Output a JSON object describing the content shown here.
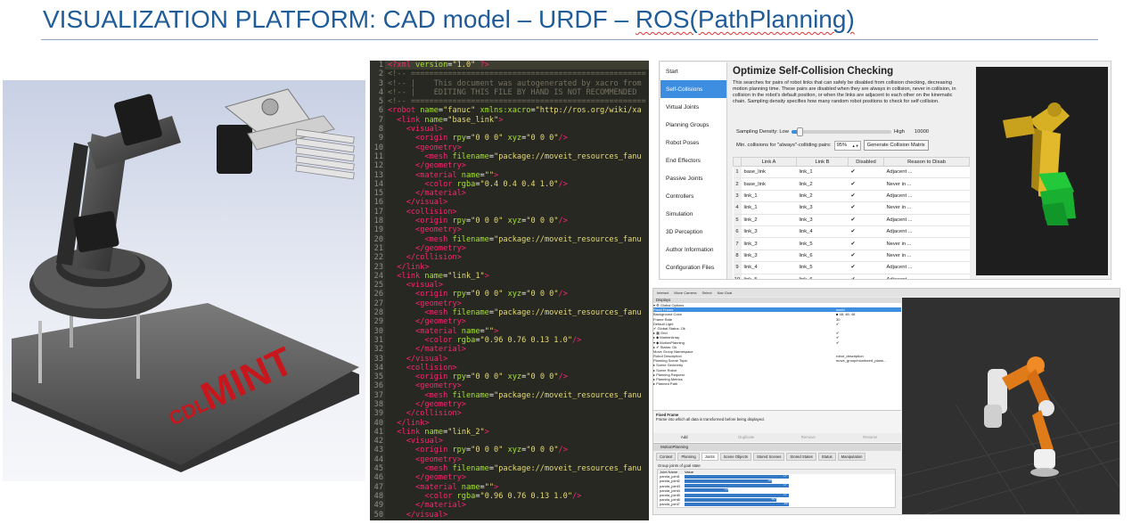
{
  "slide": {
    "title_prefix": "VISUALIZATION PLATFORM: CAD model – URDF – ",
    "title_ros": "ROS(PathPlanning)"
  },
  "cad": {
    "logo_small": "CDL",
    "logo_big": "MINT",
    "logo_color": "#c8161d"
  },
  "code": {
    "lines": [
      [
        [
          "tag",
          "<?xml "
        ],
        [
          "attr",
          "version"
        ],
        [
          "plain",
          "="
        ],
        [
          "str",
          "\"1.0\""
        ],
        [
          "tag",
          " ?>"
        ]
      ],
      [
        [
          "com",
          "<!-- ==================================================="
        ]
      ],
      [
        [
          "com",
          "<!-- |    This document was autogenerated by xacro from"
        ]
      ],
      [
        [
          "com",
          "<!-- |    EDITING THIS FILE BY HAND IS NOT RECOMMENDED"
        ]
      ],
      [
        [
          "com",
          "<!-- ==================================================="
        ]
      ],
      [
        [
          "tag",
          "<robot "
        ],
        [
          "attr",
          "name"
        ],
        [
          "plain",
          "="
        ],
        [
          "str",
          "\"fanuc\" "
        ],
        [
          "attr",
          "xmlns:xacro"
        ],
        [
          "plain",
          "="
        ],
        [
          "str",
          "\"http://ros.org/wiki/xa"
        ]
      ],
      [
        [
          "plain",
          "  "
        ],
        [
          "tag",
          "<link "
        ],
        [
          "attr",
          "name"
        ],
        [
          "plain",
          "="
        ],
        [
          "str",
          "\"base_link\""
        ],
        [
          "tag",
          ">"
        ]
      ],
      [
        [
          "plain",
          "    "
        ],
        [
          "tag",
          "<visual>"
        ]
      ],
      [
        [
          "plain",
          "      "
        ],
        [
          "tag",
          "<origin "
        ],
        [
          "attr",
          "rpy"
        ],
        [
          "plain",
          "="
        ],
        [
          "str",
          "\"0 0 0\" "
        ],
        [
          "attr",
          "xyz"
        ],
        [
          "plain",
          "="
        ],
        [
          "str",
          "\"0 0 0\""
        ],
        [
          "tag",
          "/>"
        ]
      ],
      [
        [
          "plain",
          "      "
        ],
        [
          "tag",
          "<geometry>"
        ]
      ],
      [
        [
          "plain",
          "        "
        ],
        [
          "tag",
          "<mesh "
        ],
        [
          "attr",
          "filename"
        ],
        [
          "plain",
          "="
        ],
        [
          "str",
          "\"package://moveit_resources_fanu"
        ]
      ],
      [
        [
          "plain",
          "      "
        ],
        [
          "tag",
          "</geometry>"
        ]
      ],
      [
        [
          "plain",
          "      "
        ],
        [
          "tag",
          "<material "
        ],
        [
          "attr",
          "name"
        ],
        [
          "plain",
          "="
        ],
        [
          "str",
          "\"\""
        ],
        [
          "tag",
          ">"
        ]
      ],
      [
        [
          "plain",
          "        "
        ],
        [
          "tag",
          "<color "
        ],
        [
          "attr",
          "rgba"
        ],
        [
          "plain",
          "="
        ],
        [
          "str",
          "\"0.4 0.4 0.4 1.0\""
        ],
        [
          "tag",
          "/>"
        ]
      ],
      [
        [
          "plain",
          "      "
        ],
        [
          "tag",
          "</material>"
        ]
      ],
      [
        [
          "plain",
          "    "
        ],
        [
          "tag",
          "</visual>"
        ]
      ],
      [
        [
          "plain",
          "    "
        ],
        [
          "tag",
          "<collision>"
        ]
      ],
      [
        [
          "plain",
          "      "
        ],
        [
          "tag",
          "<origin "
        ],
        [
          "attr",
          "rpy"
        ],
        [
          "plain",
          "="
        ],
        [
          "str",
          "\"0 0 0\" "
        ],
        [
          "attr",
          "xyz"
        ],
        [
          "plain",
          "="
        ],
        [
          "str",
          "\"0 0 0\""
        ],
        [
          "tag",
          "/>"
        ]
      ],
      [
        [
          "plain",
          "      "
        ],
        [
          "tag",
          "<geometry>"
        ]
      ],
      [
        [
          "plain",
          "        "
        ],
        [
          "tag",
          "<mesh "
        ],
        [
          "attr",
          "filename"
        ],
        [
          "plain",
          "="
        ],
        [
          "str",
          "\"package://moveit_resources_fanu"
        ]
      ],
      [
        [
          "plain",
          "      "
        ],
        [
          "tag",
          "</geometry>"
        ]
      ],
      [
        [
          "plain",
          "    "
        ],
        [
          "tag",
          "</collision>"
        ]
      ],
      [
        [
          "plain",
          "  "
        ],
        [
          "tag",
          "</link>"
        ]
      ],
      [
        [
          "plain",
          "  "
        ],
        [
          "tag",
          "<link "
        ],
        [
          "attr",
          "name"
        ],
        [
          "plain",
          "="
        ],
        [
          "str",
          "\"link_1\""
        ],
        [
          "tag",
          ">"
        ]
      ],
      [
        [
          "plain",
          "    "
        ],
        [
          "tag",
          "<visual>"
        ]
      ],
      [
        [
          "plain",
          "      "
        ],
        [
          "tag",
          "<origin "
        ],
        [
          "attr",
          "rpy"
        ],
        [
          "plain",
          "="
        ],
        [
          "str",
          "\"0 0 0\" "
        ],
        [
          "attr",
          "xyz"
        ],
        [
          "plain",
          "="
        ],
        [
          "str",
          "\"0 0 0\""
        ],
        [
          "tag",
          "/>"
        ]
      ],
      [
        [
          "plain",
          "      "
        ],
        [
          "tag",
          "<geometry>"
        ]
      ],
      [
        [
          "plain",
          "        "
        ],
        [
          "tag",
          "<mesh "
        ],
        [
          "attr",
          "filename"
        ],
        [
          "plain",
          "="
        ],
        [
          "str",
          "\"package://moveit_resources_fanu"
        ]
      ],
      [
        [
          "plain",
          "      "
        ],
        [
          "tag",
          "</geometry>"
        ]
      ],
      [
        [
          "plain",
          "      "
        ],
        [
          "tag",
          "<material "
        ],
        [
          "attr",
          "name"
        ],
        [
          "plain",
          "="
        ],
        [
          "str",
          "\"\""
        ],
        [
          "tag",
          ">"
        ]
      ],
      [
        [
          "plain",
          "        "
        ],
        [
          "tag",
          "<color "
        ],
        [
          "attr",
          "rgba"
        ],
        [
          "plain",
          "="
        ],
        [
          "str",
          "\"0.96 0.76 0.13 1.0\""
        ],
        [
          "tag",
          "/>"
        ]
      ],
      [
        [
          "plain",
          "      "
        ],
        [
          "tag",
          "</material>"
        ]
      ],
      [
        [
          "plain",
          "    "
        ],
        [
          "tag",
          "</visual>"
        ]
      ],
      [
        [
          "plain",
          "    "
        ],
        [
          "tag",
          "<collision>"
        ]
      ],
      [
        [
          "plain",
          "      "
        ],
        [
          "tag",
          "<origin "
        ],
        [
          "attr",
          "rpy"
        ],
        [
          "plain",
          "="
        ],
        [
          "str",
          "\"0 0 0\" "
        ],
        [
          "attr",
          "xyz"
        ],
        [
          "plain",
          "="
        ],
        [
          "str",
          "\"0 0 0\""
        ],
        [
          "tag",
          "/>"
        ]
      ],
      [
        [
          "plain",
          "      "
        ],
        [
          "tag",
          "<geometry>"
        ]
      ],
      [
        [
          "plain",
          "        "
        ],
        [
          "tag",
          "<mesh "
        ],
        [
          "attr",
          "filename"
        ],
        [
          "plain",
          "="
        ],
        [
          "str",
          "\"package://moveit_resources_fanu"
        ]
      ],
      [
        [
          "plain",
          "      "
        ],
        [
          "tag",
          "</geometry>"
        ]
      ],
      [
        [
          "plain",
          "    "
        ],
        [
          "tag",
          "</collision>"
        ]
      ],
      [
        [
          "plain",
          "  "
        ],
        [
          "tag",
          "</link>"
        ]
      ],
      [
        [
          "plain",
          "  "
        ],
        [
          "tag",
          "<link "
        ],
        [
          "attr",
          "name"
        ],
        [
          "plain",
          "="
        ],
        [
          "str",
          "\"link_2\""
        ],
        [
          "tag",
          ">"
        ]
      ],
      [
        [
          "plain",
          "    "
        ],
        [
          "tag",
          "<visual>"
        ]
      ],
      [
        [
          "plain",
          "      "
        ],
        [
          "tag",
          "<origin "
        ],
        [
          "attr",
          "rpy"
        ],
        [
          "plain",
          "="
        ],
        [
          "str",
          "\"0 0 0\" "
        ],
        [
          "attr",
          "xyz"
        ],
        [
          "plain",
          "="
        ],
        [
          "str",
          "\"0 0 0\""
        ],
        [
          "tag",
          "/>"
        ]
      ],
      [
        [
          "plain",
          "      "
        ],
        [
          "tag",
          "<geometry>"
        ]
      ],
      [
        [
          "plain",
          "        "
        ],
        [
          "tag",
          "<mesh "
        ],
        [
          "attr",
          "filename"
        ],
        [
          "plain",
          "="
        ],
        [
          "str",
          "\"package://moveit_resources_fanu"
        ]
      ],
      [
        [
          "plain",
          "      "
        ],
        [
          "tag",
          "</geometry>"
        ]
      ],
      [
        [
          "plain",
          "      "
        ],
        [
          "tag",
          "<material "
        ],
        [
          "attr",
          "name"
        ],
        [
          "plain",
          "="
        ],
        [
          "str",
          "\"\""
        ],
        [
          "tag",
          ">"
        ]
      ],
      [
        [
          "plain",
          "        "
        ],
        [
          "tag",
          "<color "
        ],
        [
          "attr",
          "rgba"
        ],
        [
          "plain",
          "="
        ],
        [
          "str",
          "\"0.96 0.76 0.13 1.0\""
        ],
        [
          "tag",
          "/>"
        ]
      ],
      [
        [
          "plain",
          "      "
        ],
        [
          "tag",
          "</material>"
        ]
      ],
      [
        [
          "plain",
          "    "
        ],
        [
          "tag",
          "</visual>"
        ]
      ]
    ]
  },
  "setup_assistant": {
    "sidebar": [
      "Start",
      "Self-Collisions",
      "Virtual Joints",
      "Planning Groups",
      "Robot Poses",
      "End Effectors",
      "Passive Joints",
      "Controllers",
      "Simulation",
      "3D Perception",
      "Author Information",
      "Configuration Files"
    ],
    "active_index": 1,
    "title": "Optimize Self-Collision Checking",
    "description": "This searches for pairs of robot links that can safely be disabled from collision checking, decreasing motion planning time. These pairs are disabled when they are always in collision, never in collision, in collision in the robot's default position, or when the links are adjacent to each other on the kinematic chain. Sampling density specifies how many random robot positions to check for self collision.",
    "density_label": "Sampling Density: Low",
    "density_high": "High",
    "density_value": "10000",
    "density_fraction": 0.08,
    "min_collisions_label": "Min. collisions for \"always\"-colliding pairs:",
    "min_collisions_value": "95%",
    "generate_button": "Generate Collision Matrix",
    "columns": [
      "Link A",
      "Link B",
      "Disabled",
      "Reason to Disab"
    ],
    "rows": [
      {
        "n": "1",
        "a": "base_link",
        "b": "link_1",
        "d": "✔",
        "r": "Adjacent ..."
      },
      {
        "n": "2",
        "a": "base_link",
        "b": "link_2",
        "d": "✔",
        "r": "Never in ..."
      },
      {
        "n": "3",
        "a": "link_1",
        "b": "link_2",
        "d": "✔",
        "r": "Adjacent ..."
      },
      {
        "n": "4",
        "a": "link_1",
        "b": "link_3",
        "d": "✔",
        "r": "Never in ..."
      },
      {
        "n": "5",
        "a": "link_2",
        "b": "link_3",
        "d": "✔",
        "r": "Adjacent ..."
      },
      {
        "n": "6",
        "a": "link_3",
        "b": "link_4",
        "d": "✔",
        "r": "Adjacent ..."
      },
      {
        "n": "7",
        "a": "link_3",
        "b": "link_5",
        "d": "✔",
        "r": "Never in ..."
      },
      {
        "n": "8",
        "a": "link_3",
        "b": "link_6",
        "d": "✔",
        "r": "Never in ..."
      },
      {
        "n": "9",
        "a": "link_4",
        "b": "link_5",
        "d": "✔",
        "r": "Adjacent ..."
      },
      {
        "n": "10",
        "a": "link_5",
        "b": "link_6",
        "d": "✔",
        "r": "Adjacent ..."
      }
    ]
  },
  "rviz": {
    "toolbar": [
      "Interact",
      "Move Camera",
      "Select",
      "Nav Goal"
    ],
    "displays_header": "Displays",
    "tree": [
      {
        "k": "▾ ⚙ Global Options",
        "v": ""
      },
      {
        "k": "      Fixed Frame",
        "v": "world",
        "sel": true
      },
      {
        "k": "      Background Color",
        "v": "■ 48; 48; 48"
      },
      {
        "k": "      Frame Rate",
        "v": "30"
      },
      {
        "k": "      Default Light",
        "v": "✔"
      },
      {
        "k": "  ✔ Global Status: Ok",
        "v": ""
      },
      {
        "k": "▸ ▦ Grid",
        "v": "✔"
      },
      {
        "k": "▸ ◆ MarkerArray",
        "v": "✔"
      },
      {
        "k": "▾ ◆ MotionPlanning",
        "v": "✔"
      },
      {
        "k": "   ▸ ✔ Status: Ok",
        "v": ""
      },
      {
        "k": "      Move Group Namespace",
        "v": ""
      },
      {
        "k": "      Robot Description",
        "v": "robot_description"
      },
      {
        "k": "      Planning Scene Topic",
        "v": "move_group/monitored_plann..."
      },
      {
        "k": "   ▸ Scene Geometry",
        "v": ""
      },
      {
        "k": "   ▸ Scene Robot",
        "v": ""
      },
      {
        "k": "   ▸ Planning Request",
        "v": ""
      },
      {
        "k": "   ▸ Planning Metrics",
        "v": ""
      },
      {
        "k": "   ▸ Planned Path",
        "v": ""
      }
    ],
    "ff_title": "Fixed Frame",
    "ff_desc": "Frame into which all data is transformed before being displayed.",
    "buttons": [
      "Add",
      "Duplicate",
      "Remove",
      "Rename"
    ],
    "mp_header": "MotionPlanning",
    "tabs": [
      "Context",
      "Planning",
      "Joints",
      "Scene Objects",
      "Stored Scenes",
      "Stored States",
      "Status",
      "Manipulation"
    ],
    "active_tab": 2,
    "group_label": "Group joints of goal state",
    "joint_cols": [
      "Joint Name",
      "Value"
    ],
    "joints": [
      {
        "name": "panda_joint1",
        "label": "0°",
        "frac": 0.5
      },
      {
        "name": "panda_joint2",
        "label": "-45°",
        "frac": 0.42
      },
      {
        "name": "panda_joint3",
        "label": "0°",
        "frac": 0.5
      },
      {
        "name": "panda_joint4",
        "label": "-135°",
        "frac": 0.21
      },
      {
        "name": "panda_joint5",
        "label": "0°",
        "frac": 0.5
      },
      {
        "name": "panda_joint6",
        "label": "90°",
        "frac": 0.44
      },
      {
        "name": "panda_joint7",
        "label": "45°",
        "frac": 0.5
      }
    ]
  }
}
